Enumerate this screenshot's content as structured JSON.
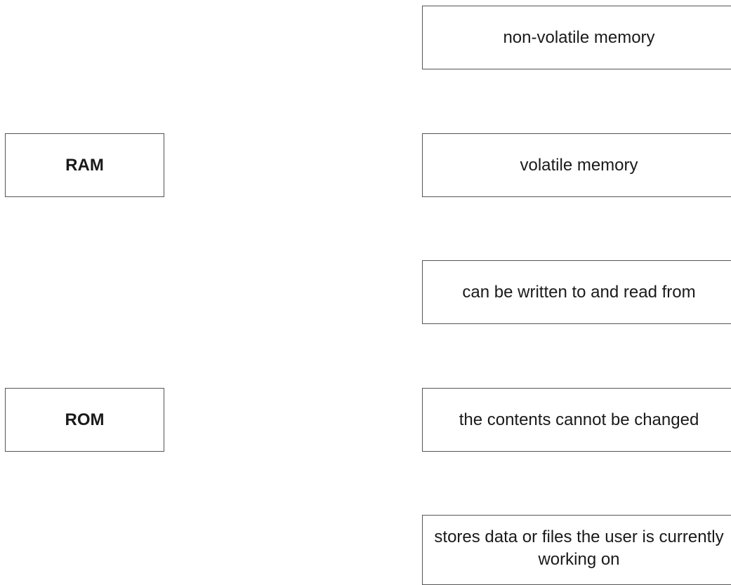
{
  "terms": [
    {
      "label": "RAM"
    },
    {
      "label": "ROM"
    }
  ],
  "descriptions": [
    {
      "label": "non-volatile memory"
    },
    {
      "label": "volatile memory"
    },
    {
      "label": "can be written to and read from"
    },
    {
      "label": "the contents cannot be changed"
    },
    {
      "label": "stores data or files the user is currently working on"
    }
  ]
}
